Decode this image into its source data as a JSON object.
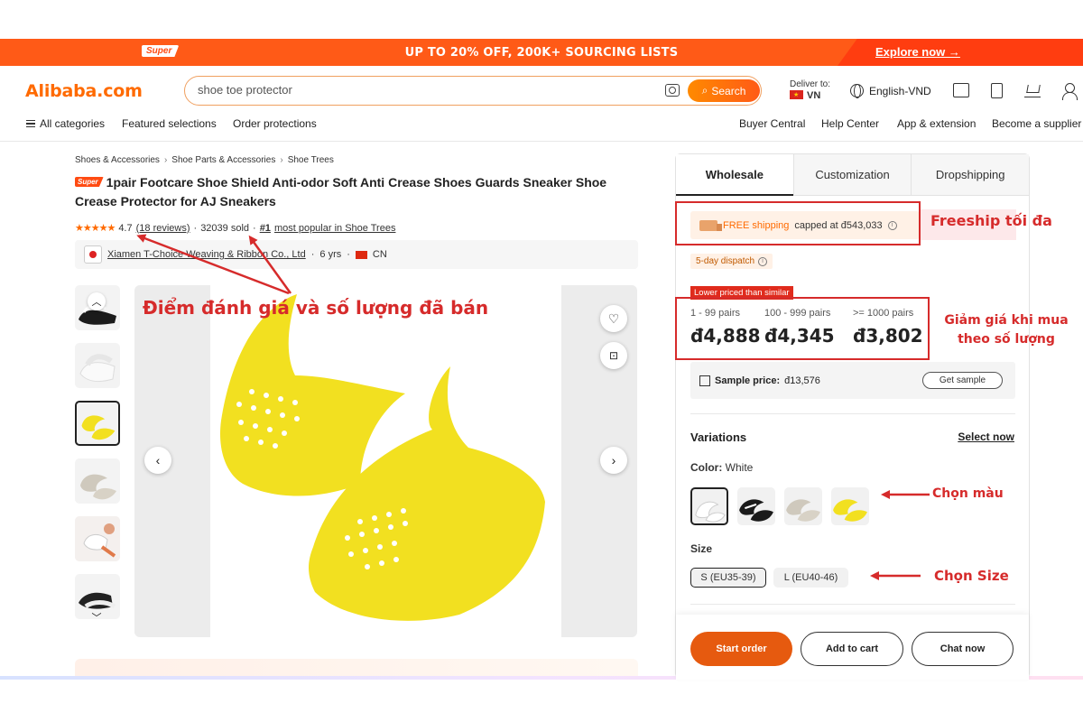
{
  "promo": {
    "badge": "Super",
    "text": "UP TO 20% OFF, 200K+ SOURCING LISTS",
    "explore": "Explore now →"
  },
  "header": {
    "logo": "Alibaba.com",
    "search_value": "shoe toe protector",
    "search_button": "Search",
    "deliver_label": "Deliver to:",
    "deliver_country": "VN",
    "language": "English-VND"
  },
  "subnav": {
    "left": [
      "All categories",
      "Featured selections",
      "Order protections"
    ],
    "right": [
      "Buyer Central",
      "Help Center",
      "App & extension",
      "Become a supplier"
    ]
  },
  "product": {
    "breadcrumb": [
      "Shoes & Accessories",
      "Shoe Parts & Accessories",
      "Shoe Trees"
    ],
    "badge": "Super",
    "title": "1pair Footcare Shoe Shield Anti-odor Soft Anti Crease Shoes Guards Sneaker Shoe Crease Protector for AJ Sneakers",
    "stars": "★★★★★",
    "rating": "4.7",
    "reviews": "(18 reviews)",
    "sold": "32039 sold",
    "popular_rank": "#1",
    "popular_text": "most popular in Shoe Trees",
    "supplier": "Xiamen T-Choice Weaving & Ribbon Co., Ltd",
    "years": "6 yrs",
    "country": "CN"
  },
  "panel": {
    "tabs": [
      "Wholesale",
      "Customization",
      "Dropshipping"
    ],
    "active_tab": "Wholesale",
    "shipping_prefix": "FREE shipping",
    "shipping_suffix": "capped at đ543,033",
    "dispatch": "5-day dispatch",
    "lower_badge": "Lower priced than similar",
    "tiers": [
      {
        "qty": "1 - 99 pairs",
        "price": "đ4,888"
      },
      {
        "qty": "100 - 999 pairs",
        "price": "đ4,345"
      },
      {
        "qty": ">= 1000 pairs",
        "price": "đ3,802"
      }
    ],
    "sample_label": "Sample price:",
    "sample_price": "đ13,576",
    "get_sample": "Get sample",
    "variations_title": "Variations",
    "select_now": "Select now",
    "color_label": "Color:",
    "color_value": "White",
    "colors": [
      "White",
      "Black",
      "Grey",
      "Yellow"
    ],
    "size_label": "Size",
    "sizes": [
      "S (EU35-39)",
      "L (EU40-46)"
    ],
    "selected_size": "S (EU35-39)",
    "buttons": {
      "start_order": "Start order",
      "add_to_cart": "Add to cart",
      "chat_now": "Chat now"
    }
  },
  "annotations": {
    "rating_sold": "Điểm đánh giá và số lượng đã bán",
    "freeship": "Freeship tối đa",
    "discount_line1": "Giảm giá khi mua",
    "discount_line2": "theo số lượng",
    "choose_color": "Chọn màu",
    "choose_size": "Chọn Size"
  },
  "colors": {
    "brand_orange": "#ff6a00",
    "promo_bg": "#ff5a17",
    "annotation_red": "#d62b2b",
    "product_yellow": "#f2e020"
  }
}
